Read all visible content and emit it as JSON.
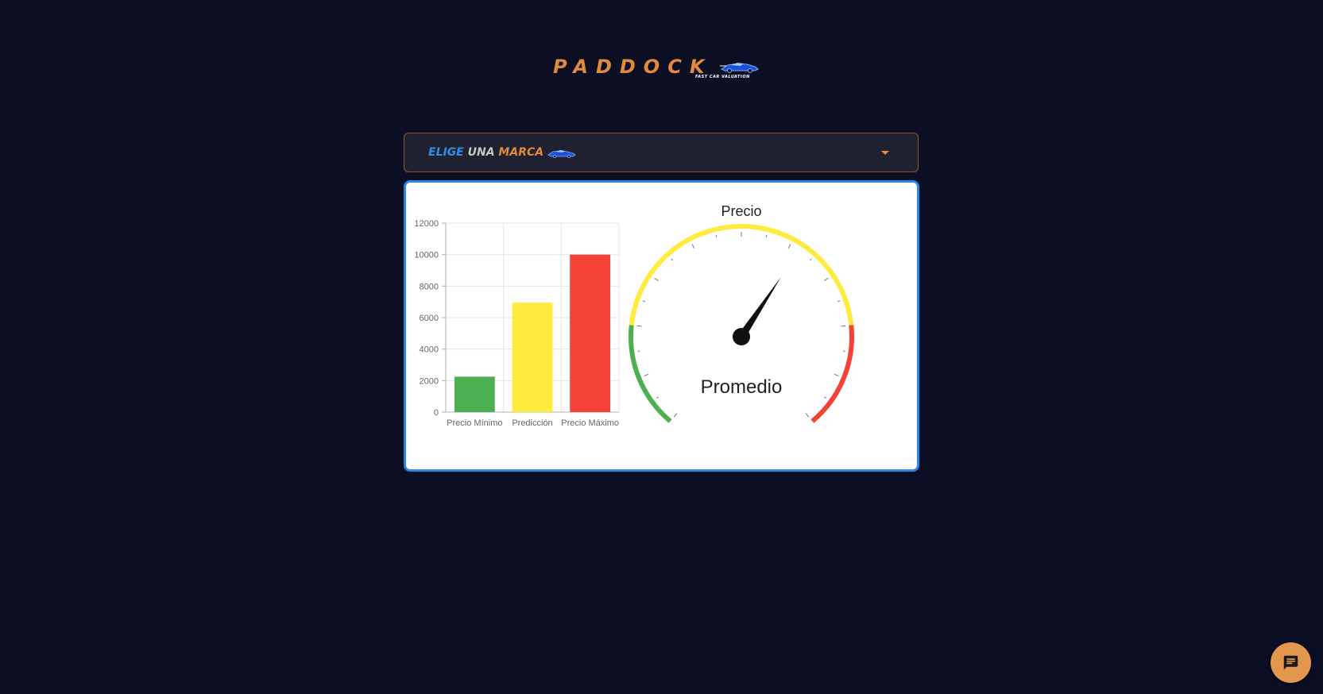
{
  "logo": {
    "word": "PADDOCK",
    "tagline": "FAST CAR VALUATION",
    "color": "#e08a3c"
  },
  "brand_select": {
    "label_parts": [
      "ELIGE ",
      "UNA ",
      "MARCA"
    ],
    "label_colors": [
      "#2f8fe8",
      "#c7c7c7",
      "#e08a3c"
    ],
    "icon": "chevron-down-icon"
  },
  "chart_data": [
    {
      "type": "bar",
      "categories": [
        "Precio Mínimo",
        "Predicción",
        "Precio Máximo"
      ],
      "values": [
        2250,
        6950,
        10000
      ],
      "colors": [
        "#4caf50",
        "#ffeb3b",
        "#f44336"
      ],
      "ylim": [
        0,
        12000
      ],
      "yticks": [
        0,
        2000,
        4000,
        6000,
        8000,
        10000,
        12000
      ],
      "grid": true
    },
    {
      "type": "gauge",
      "title": "Precio",
      "label": "Promedio",
      "value_fraction": 0.62,
      "bands": [
        {
          "from": 0,
          "to": 0.2,
          "color": "#4caf50"
        },
        {
          "from": 0.2,
          "to": 0.8,
          "color": "#ffeb3b"
        },
        {
          "from": 0.8,
          "to": 1.0,
          "color": "#f44336"
        }
      ]
    }
  ],
  "chat": {
    "icon": "chat-icon",
    "color": "#e3974e"
  }
}
